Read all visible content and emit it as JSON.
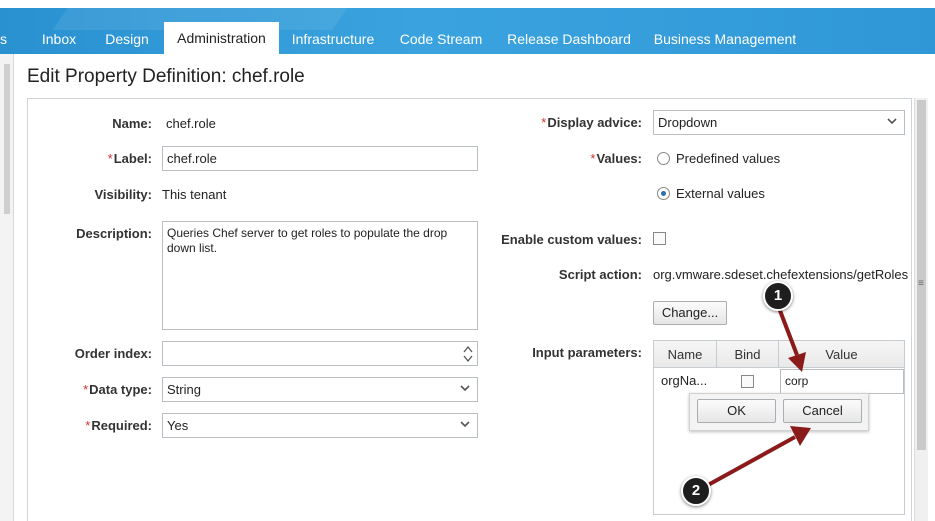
{
  "nav": {
    "tabs": [
      {
        "label": "s"
      },
      {
        "label": "Inbox"
      },
      {
        "label": "Design"
      },
      {
        "label": "Administration"
      },
      {
        "label": "Infrastructure"
      },
      {
        "label": "Code Stream"
      },
      {
        "label": "Release Dashboard"
      },
      {
        "label": "Business Management"
      }
    ],
    "active_index": 3
  },
  "page": {
    "title": "Edit Property Definition: chef.role"
  },
  "form": {
    "name": {
      "label": "Name:",
      "value": "chef.role"
    },
    "label": {
      "label": "Label:",
      "value": "chef.role"
    },
    "visibility": {
      "label": "Visibility:",
      "value": "This tenant"
    },
    "description": {
      "label": "Description:",
      "value": "Queries Chef server to get roles to populate the drop down list."
    },
    "order_index": {
      "label": "Order index:",
      "value": ""
    },
    "data_type": {
      "label": "Data type:",
      "value": "String"
    },
    "required": {
      "label": "Required:",
      "value": "Yes"
    },
    "display_advice": {
      "label": "Display advice:",
      "value": "Dropdown"
    },
    "values": {
      "label": "Values:",
      "option_predefined": "Predefined values",
      "option_external": "External values",
      "selected": "external"
    },
    "enable_custom": {
      "label": "Enable custom values:",
      "checked": false
    },
    "script_action": {
      "label": "Script action:",
      "value": "org.vmware.sdeset.chefextensions/getRoles"
    },
    "change_button": "Change...",
    "input_params": {
      "label": "Input parameters:",
      "columns": [
        "Name",
        "Bind",
        "Value"
      ],
      "rows": [
        {
          "name": "orgNa...",
          "bind": false,
          "value": "corp"
        }
      ]
    },
    "popup": {
      "ok": "OK",
      "cancel": "Cancel"
    }
  },
  "annotations": [
    {
      "number": "1"
    },
    {
      "number": "2"
    }
  ],
  "colors": {
    "nav_bg": "#2f97d6",
    "required_star": "#d0312d",
    "arrow": "#8b1a1a"
  }
}
